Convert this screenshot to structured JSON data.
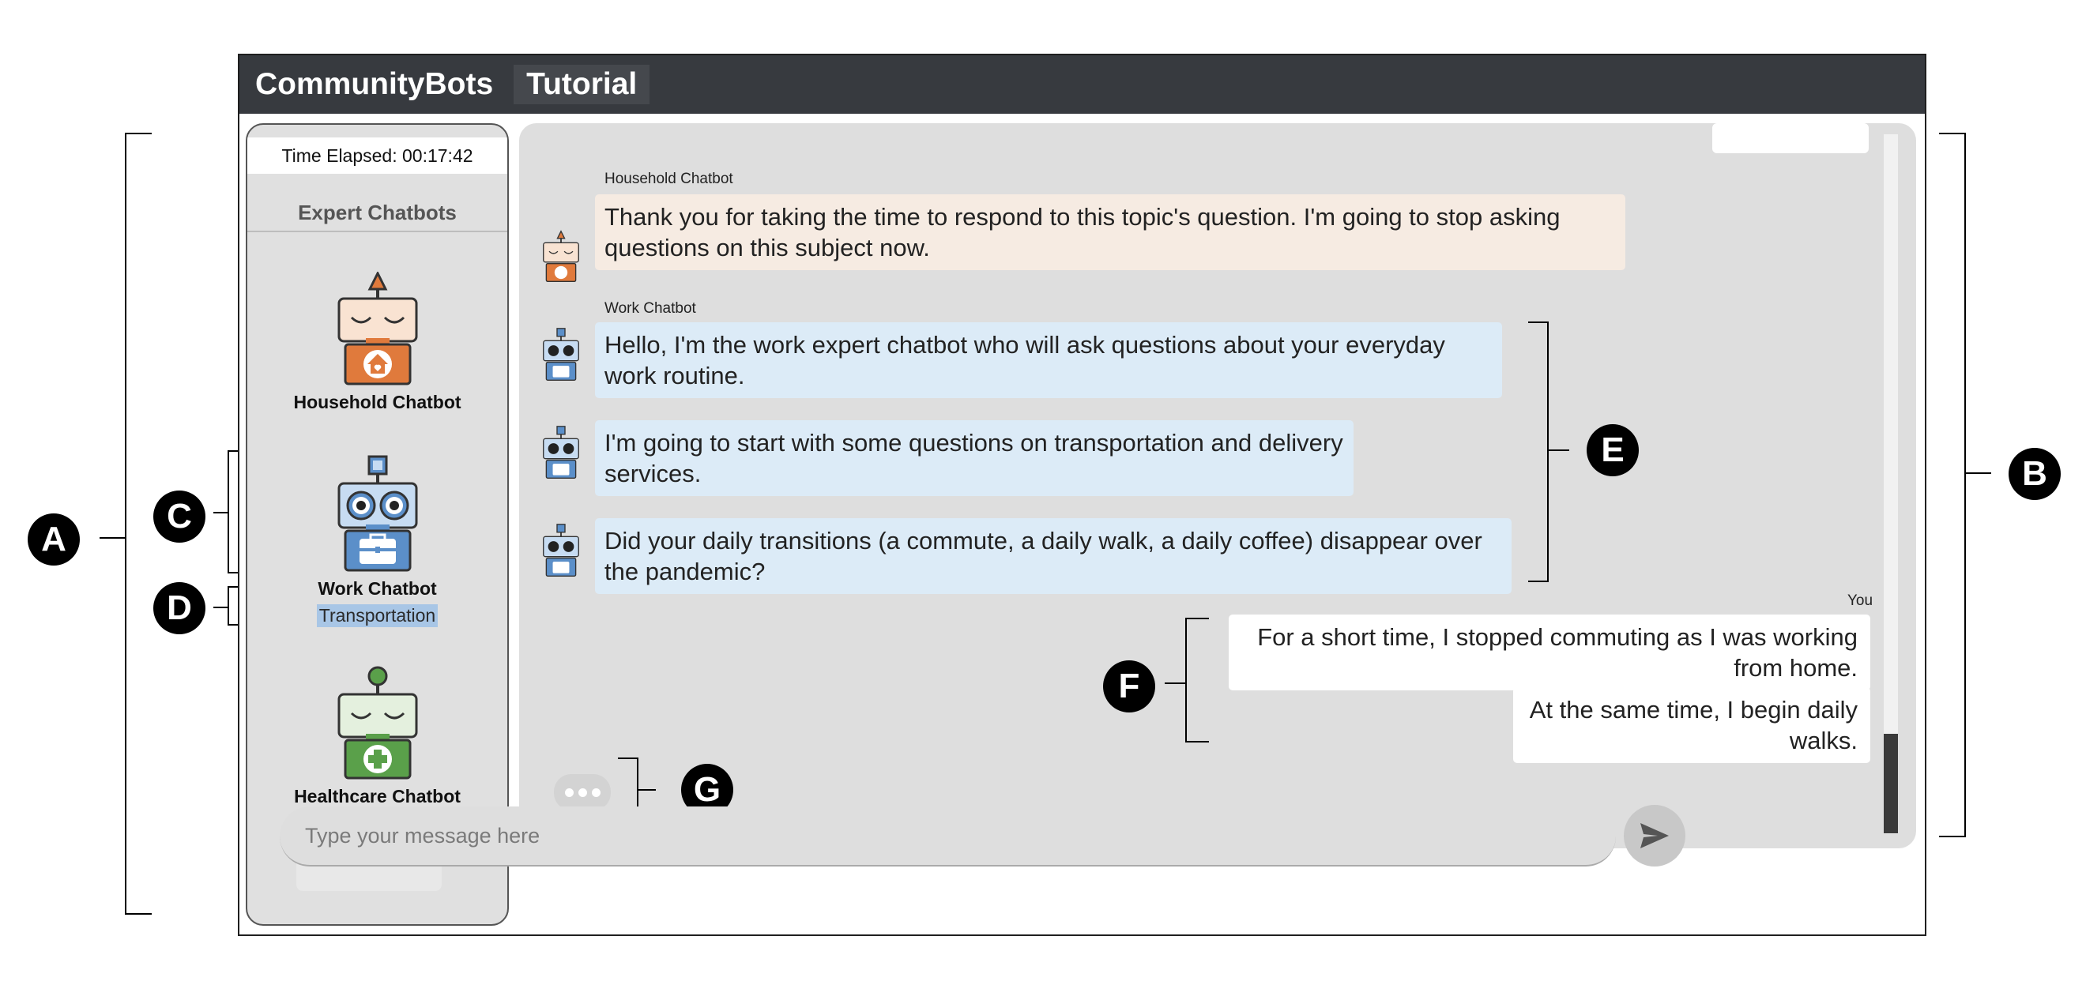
{
  "annotations": [
    "A",
    "B",
    "C",
    "D",
    "E",
    "F",
    "G"
  ],
  "header": {
    "brand": "CommunityBots",
    "tutorial": "Tutorial"
  },
  "sidebar": {
    "timer": "Time Elapsed: 00:17:42",
    "heading": "Expert Chatbots",
    "bots": [
      {
        "name": "Household Chatbot",
        "color": "#e07a3c",
        "icon": "house-icon"
      },
      {
        "name": "Work Chatbot",
        "color": "#5b8fc9",
        "icon": "briefcase-icon",
        "topic": "Transportation"
      },
      {
        "name": "Healthcare Chatbot",
        "color": "#5aa04a",
        "icon": "medical-cross-icon"
      }
    ]
  },
  "chat": {
    "messages": [
      {
        "sender": "Household Chatbot",
        "text": "Thank you for taking the time to respond to this topic's question. I'm going to stop asking questions on this subject now."
      },
      {
        "sender": "Work Chatbot",
        "text": "Hello, I'm the work expert chatbot who will ask questions about your everyday work routine."
      },
      {
        "text": "I'm going to start with some questions on transportation and delivery services."
      },
      {
        "text": "Did your daily transitions (a commute, a daily walk, a daily coffee) disappear over the pandemic?"
      },
      {
        "sender": "You",
        "text": "For a short time, I stopped commuting as I was working from home."
      },
      {
        "text": "At the same time, I begin daily walks."
      }
    ]
  },
  "input": {
    "placeholder": "Type your message here"
  },
  "colors": {
    "household": "#f6ebe2",
    "work": "#dcebf7",
    "user": "#ffffff",
    "header": "#373a3f"
  }
}
